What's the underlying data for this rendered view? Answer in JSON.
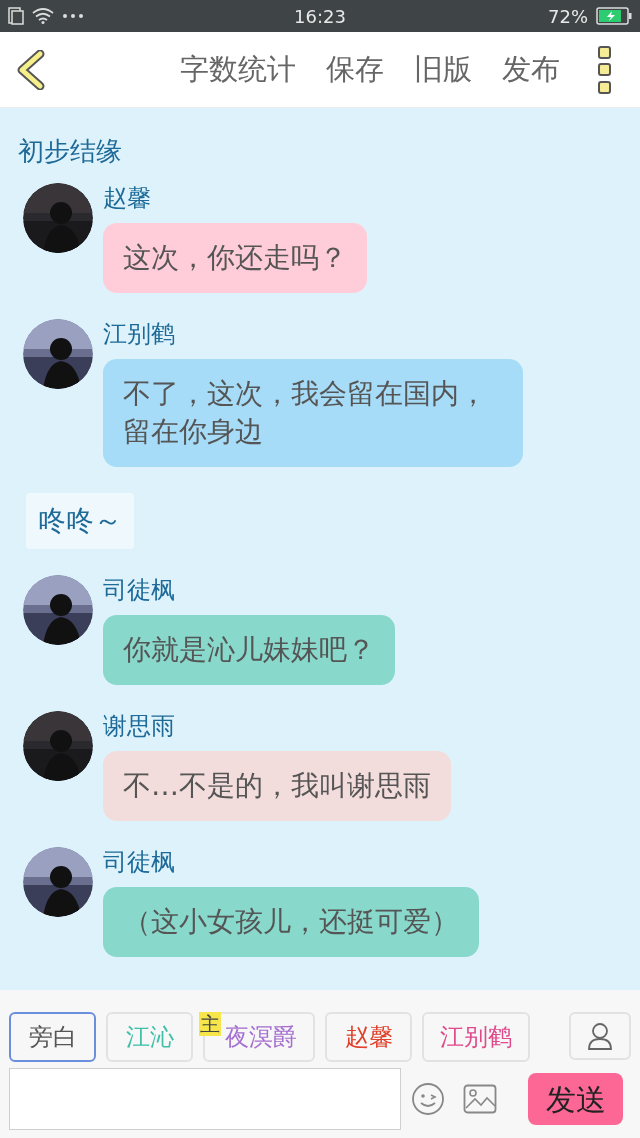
{
  "status_bar": {
    "time": "16:23",
    "battery": "72%"
  },
  "header": {
    "actions": [
      "字数统计",
      "保存",
      "旧版",
      "发布"
    ]
  },
  "section_title": "初步结缘",
  "messages": [
    {
      "kind": "message",
      "name": "赵馨",
      "text": "这次，你还走吗？",
      "color": "#ffcdd9"
    },
    {
      "kind": "message",
      "name": "江别鹤",
      "text": "不了，这次，我会留在国内，留在你身边",
      "color": "#a6dcf7"
    },
    {
      "kind": "narration",
      "text": "咚咚～"
    },
    {
      "kind": "message",
      "name": "司徒枫",
      "text": "你就是沁儿妹妹吧？",
      "color": "#88d8cb"
    },
    {
      "kind": "message",
      "name": "谢思雨",
      "text": "不…不是的，我叫谢思雨",
      "color": "#f2dcdc"
    },
    {
      "kind": "message",
      "name": "司徒枫",
      "text": "（这小女孩儿，还挺可爱）",
      "color": "#88d8cb"
    }
  ],
  "characters": [
    {
      "label": "旁白",
      "color": "#555555",
      "selected": true
    },
    {
      "label": "江沁",
      "color": "#3fbfa8",
      "selected": false
    },
    {
      "label": "夜溟爵",
      "color": "#a56fd0",
      "selected": false,
      "badge": "主"
    },
    {
      "label": "赵馨",
      "color": "#e0402a",
      "selected": false
    },
    {
      "label": "江别鹤",
      "color": "#e04a8a",
      "selected": false
    }
  ],
  "send_button": "发送"
}
